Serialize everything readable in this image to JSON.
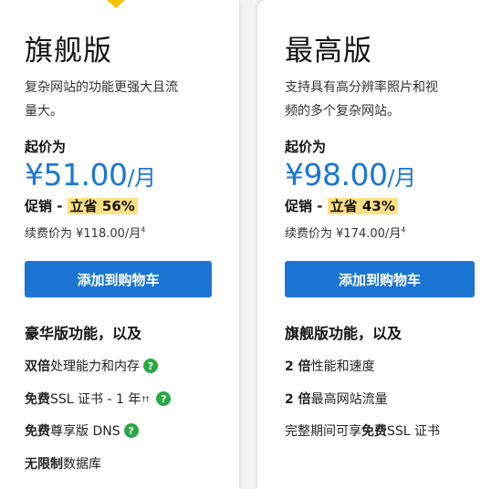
{
  "plans": [
    {
      "name": "旗舰版",
      "desc_line1": "复杂网站的功能更强大且流",
      "desc_line2": "量大。",
      "from_label": "起价为",
      "price": "¥51.00",
      "per": "/月",
      "promo_label": "促销 - ",
      "promo_highlight": "立省 56%",
      "renew_text": "续费价为 ¥118.00/月",
      "renew_sup": "4",
      "button_label": "添加到购物车",
      "features_title": "豪华版功能，以及",
      "features": [
        {
          "bold": "双倍",
          "text": "处理能力和内存",
          "sup": "",
          "help": true
        },
        {
          "bold": "免费",
          "text": " SSL 证书 - 1 年",
          "sup": "††",
          "help": true
        },
        {
          "bold": "免费",
          "text": " 尊享版 DNS",
          "sup": "",
          "help": true
        },
        {
          "bold": "无限制",
          "text": "数据库",
          "sup": "",
          "help": false
        }
      ]
    },
    {
      "name": "最高版",
      "desc_line1": "支持具有高分辨率照片和视",
      "desc_line2": "频的多个复杂网站。",
      "from_label": "起价为",
      "price": "¥98.00",
      "per": "/月",
      "promo_label": "促销 - ",
      "promo_highlight": "立省 43%",
      "renew_text": "续费价为 ¥174.00/月",
      "renew_sup": "4",
      "button_label": "添加到购物车",
      "features_title": "旗舰版功能，以及",
      "features": [
        {
          "bold": "2 倍",
          "text": "性能和速度"
        },
        {
          "bold": "2 倍",
          "text": "最高网站流量"
        },
        {
          "pre": "完整期间可享",
          "bold": "免费",
          "text": " SSL 证书"
        }
      ]
    }
  ],
  "help_icon_glyph": "?",
  "colors": {
    "accent": "#1b76d3",
    "highlight": "#ffe082",
    "help": "#2aa844",
    "ribbon": "#f5c400"
  }
}
